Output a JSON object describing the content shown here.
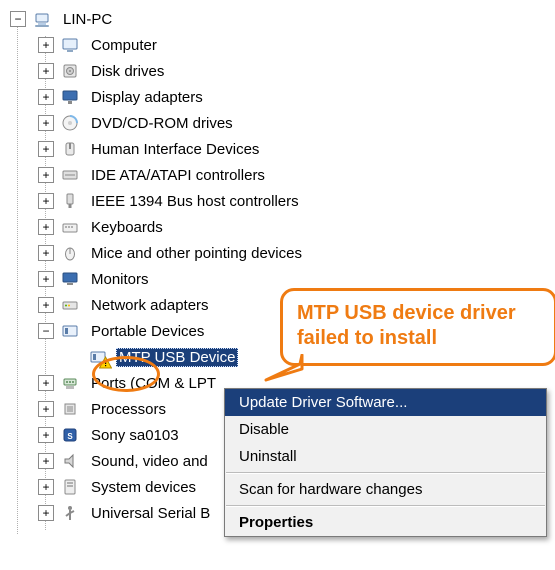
{
  "root": {
    "name": "LIN-PC",
    "expander": "−"
  },
  "categories": [
    {
      "label": "Computer",
      "expander": "+",
      "icon": "computer"
    },
    {
      "label": "Disk drives",
      "expander": "+",
      "icon": "disk"
    },
    {
      "label": "Display adapters",
      "expander": "+",
      "icon": "display"
    },
    {
      "label": "DVD/CD-ROM drives",
      "expander": "+",
      "icon": "dvd"
    },
    {
      "label": "Human Interface Devices",
      "expander": "+",
      "icon": "hid"
    },
    {
      "label": "IDE ATA/ATAPI controllers",
      "expander": "+",
      "icon": "ide"
    },
    {
      "label": "IEEE 1394 Bus host controllers",
      "expander": "+",
      "icon": "ieee"
    },
    {
      "label": "Keyboards",
      "expander": "+",
      "icon": "keyboard"
    },
    {
      "label": "Mice and other pointing devices",
      "expander": "+",
      "icon": "mouse"
    },
    {
      "label": "Monitors",
      "expander": "+",
      "icon": "monitor"
    },
    {
      "label": "Network adapters",
      "expander": "+",
      "icon": "network"
    },
    {
      "label": "Portable Devices",
      "expander": "−",
      "icon": "portable"
    },
    {
      "label": "Ports (COM & LPT",
      "expander": "+",
      "icon": "ports"
    },
    {
      "label": "Processors",
      "expander": "+",
      "icon": "cpu"
    },
    {
      "label": "Sony sa0103",
      "expander": "+",
      "icon": "sony"
    },
    {
      "label": "Sound, video and",
      "expander": "+",
      "icon": "sound"
    },
    {
      "label": "System devices",
      "expander": "+",
      "icon": "system"
    },
    {
      "label": "Universal Serial B",
      "expander": "+",
      "icon": "usb"
    }
  ],
  "portable_child": {
    "label": "MTP USB Device",
    "has_warning": true
  },
  "context_menu": {
    "items": [
      "Update Driver Software...",
      "Disable",
      "Uninstall",
      "Scan for hardware changes",
      "Properties"
    ],
    "highlighted_index": 0,
    "default_index": 4
  },
  "callout_text": "MTP USB device driver failed to install"
}
